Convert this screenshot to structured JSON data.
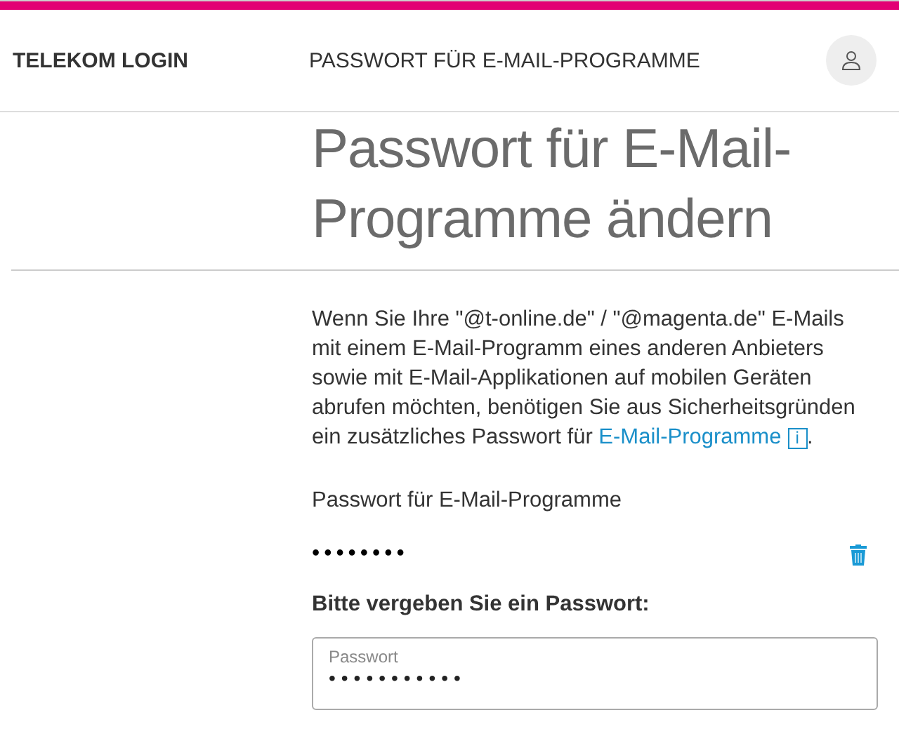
{
  "header": {
    "brand": "TELEKOM LOGIN",
    "title": "PASSWORT FÜR E-MAIL-PROGRAMME"
  },
  "heading": "Passwort für E-Mail-Programme ändern",
  "intro": {
    "text": "Wenn Sie Ihre \"@t-online.de\" / \"@magenta.de\" E-Mails mit einem E-Mail-Programm eines anderen Anbieters sowie mit E-Mail-Applikationen auf mobilen Geräten abrufen möchten, benötigen Sie aus Sicherheitsgründen ein zusätzliches Passwort für ",
    "link": "E-Mail-Programme",
    "info": "i",
    "end": "."
  },
  "current": {
    "label": "Passwort für E-Mail-Programme",
    "value": "••••••••"
  },
  "new_password": {
    "heading": "Bitte vergeben Sie ein Passwort:",
    "label": "Passwort",
    "value": "•••••••••••"
  }
}
